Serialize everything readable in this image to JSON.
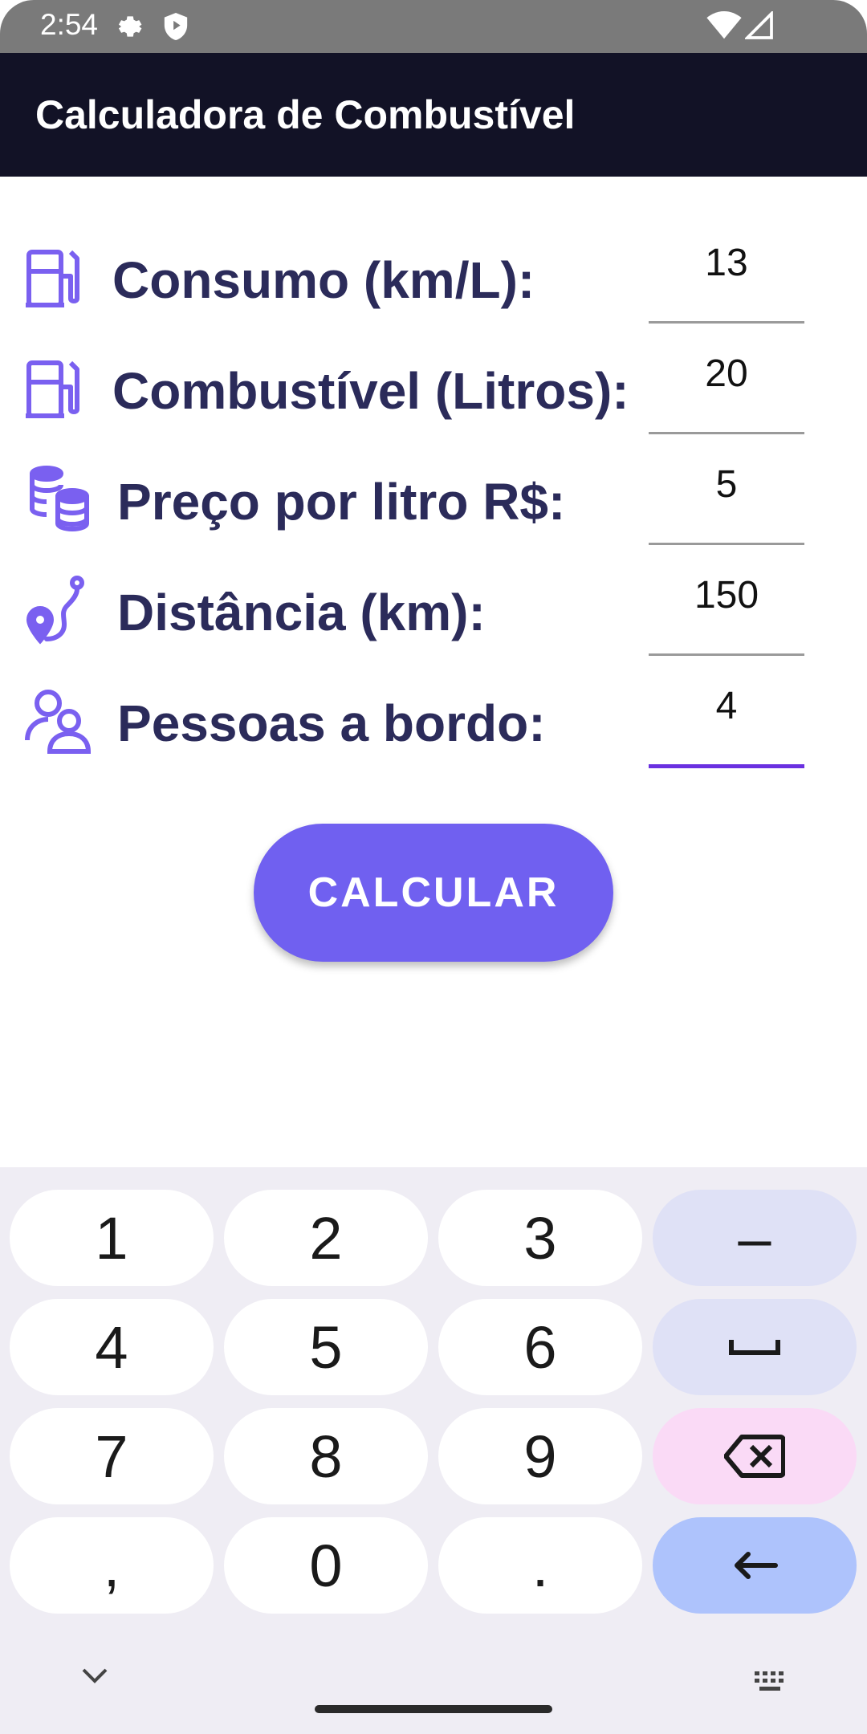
{
  "status_bar": {
    "time": "2:54",
    "icons": [
      "settings-icon",
      "shield-icon",
      "wifi-icon",
      "signal-icon"
    ]
  },
  "app_bar": {
    "title": "Calculadora de Combustível"
  },
  "form": {
    "rows": [
      {
        "icon": "fuel-pump-icon",
        "label": "Consumo (km/L):",
        "value": "13"
      },
      {
        "icon": "fuel-pump-icon",
        "label": "Combustível (Litros):",
        "value": "20"
      },
      {
        "icon": "coins-stack-icon",
        "label": "Preço por litro R$:",
        "value": "5"
      },
      {
        "icon": "route-pin-icon",
        "label": "Distância (km):",
        "value": "150"
      },
      {
        "icon": "people-icon",
        "label": "Pessoas a bordo:",
        "value": "4"
      }
    ]
  },
  "calculate_button": {
    "label": "CALCULAR"
  },
  "keyboard": {
    "keys": [
      "1",
      "2",
      "3",
      "–",
      "4",
      "5",
      "6",
      "␣",
      "7",
      "8",
      "9",
      "⌫",
      ",",
      "0",
      ".",
      "↵"
    ],
    "icons": [
      "backspace-icon",
      "enter-icon",
      "space-icon",
      "chevron-down-icon",
      "keyboard-icon"
    ]
  },
  "colors": {
    "app_bar": "#121226",
    "accent": "#7060f0",
    "icon": "#7a60f0",
    "label": "#2b2b5a",
    "active_underline": "#6a30e0"
  }
}
